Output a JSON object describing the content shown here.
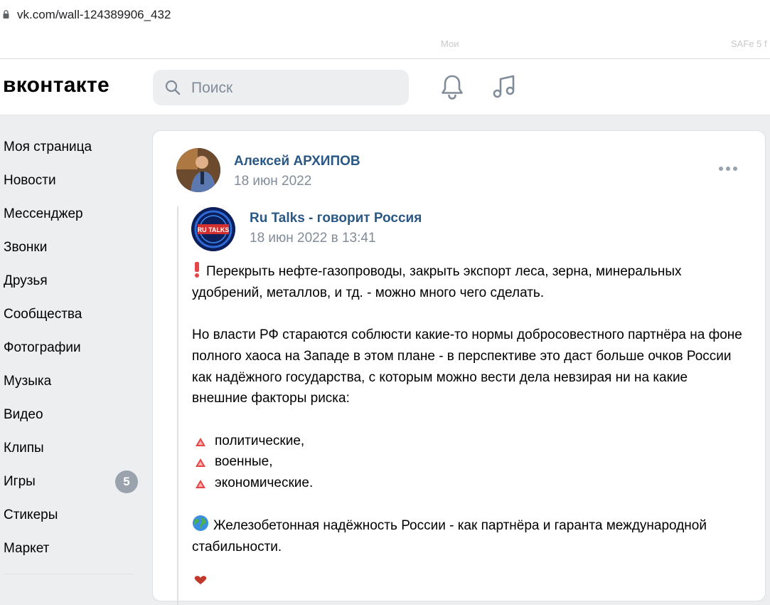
{
  "browser": {
    "url": "vk.com/wall-124389906_432",
    "bookmarks": [
      "Мои",
      "SAFe 5 f"
    ]
  },
  "header": {
    "logo_text": "вконтакте",
    "search_placeholder": "Поиск",
    "icons": [
      "bell-icon",
      "music-note-icon"
    ]
  },
  "sidebar": {
    "items": [
      {
        "label": "Моя страница"
      },
      {
        "label": "Новости"
      },
      {
        "label": "Мессенджер"
      },
      {
        "label": "Звонки"
      },
      {
        "label": "Друзья"
      },
      {
        "label": "Сообщества"
      },
      {
        "label": "Фотографии"
      },
      {
        "label": "Музыка"
      },
      {
        "label": "Видео"
      },
      {
        "label": "Клипы"
      },
      {
        "label": "Игры",
        "badge": "5"
      },
      {
        "label": "Стикеры"
      },
      {
        "label": "Маркет"
      }
    ]
  },
  "post": {
    "author": "Алексей АРХИПОВ",
    "date": "18 июн 2022",
    "repost": {
      "author": "Ru Talks - говорит Россия",
      "date": "18 июн 2022 в 13:41",
      "avatar_text": "RU TALKS",
      "paragraph1": "Перекрыть нефте-газопроводы, закрыть экспорт леса, зерна, минеральных удобрений, металлов, и тд. - можно много чего сделать.",
      "paragraph2": "Но власти РФ стараются соблюсти какие-то нормы добросовестного партнёра на фоне полного хаоса на Западе в этом плане - в перспективе это даст больше очков России как надёжного государства, с которым можно вести дела невзирая ни на какие внешние факторы риска:",
      "bullets": [
        "политические,",
        "военные,",
        "экономические."
      ],
      "paragraph3": "Железобетонная надёжность России - как партнёра и гаранта международной стабильности."
    }
  },
  "colors": {
    "link": "#2a5885",
    "secondary": "#818c99",
    "background": "#edeef0",
    "badge": "#99a2ad",
    "alert_red": "#e64646"
  }
}
